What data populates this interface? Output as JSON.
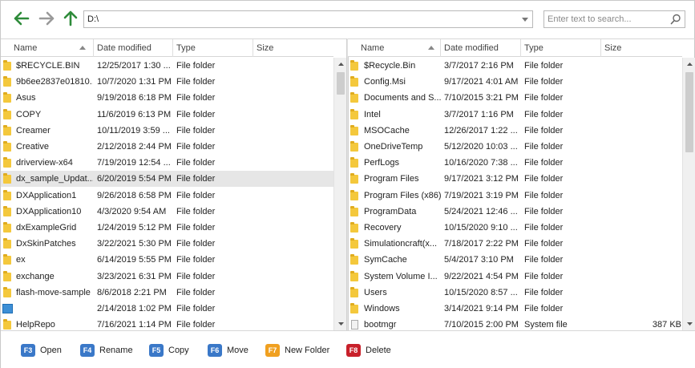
{
  "toolbar": {
    "address_value": "D:\\",
    "search_placeholder": "Enter text to search..."
  },
  "columns": {
    "name": "Name",
    "date": "Date modified",
    "type": "Type",
    "size": "Size"
  },
  "left_pane": {
    "rows": [
      {
        "name": "$RECYCLE.BIN",
        "date": "12/25/2017 1:30 ...",
        "type": "File folder",
        "size": "",
        "icon": "folder-icon"
      },
      {
        "name": "9b6ee2837e01810...",
        "date": "10/7/2020 1:31 PM",
        "type": "File folder",
        "size": "",
        "icon": "folder-icon"
      },
      {
        "name": "Asus",
        "date": "9/19/2018 6:18 PM",
        "type": "File folder",
        "size": "",
        "icon": "folder-icon"
      },
      {
        "name": "COPY",
        "date": "11/6/2019 6:13 PM",
        "type": "File folder",
        "size": "",
        "icon": "folder-icon"
      },
      {
        "name": "Creamer",
        "date": "10/11/2019 3:59 ...",
        "type": "File folder",
        "size": "",
        "icon": "folder-icon"
      },
      {
        "name": "Creative",
        "date": "2/12/2018 2:44 PM",
        "type": "File folder",
        "size": "",
        "icon": "folder-icon"
      },
      {
        "name": "driverview-x64",
        "date": "7/19/2019 12:54 ...",
        "type": "File folder",
        "size": "",
        "icon": "folder-icon"
      },
      {
        "name": "dx_sample_Updat...",
        "date": "6/20/2019 5:54 PM",
        "type": "File folder",
        "size": "",
        "icon": "folder-icon"
      },
      {
        "name": "DXApplication1",
        "date": "9/26/2018 6:58 PM",
        "type": "File folder",
        "size": "",
        "icon": "folder-icon"
      },
      {
        "name": "DXApplication10",
        "date": "4/3/2020 9:54 AM",
        "type": "File folder",
        "size": "",
        "icon": "folder-icon"
      },
      {
        "name": "dxExampleGrid",
        "date": "1/24/2019 5:12 PM",
        "type": "File folder",
        "size": "",
        "icon": "folder-icon"
      },
      {
        "name": "DxSkinPatches",
        "date": "3/22/2021 5:30 PM",
        "type": "File folder",
        "size": "",
        "icon": "folder-icon"
      },
      {
        "name": "ex",
        "date": "6/14/2019 5:55 PM",
        "type": "File folder",
        "size": "",
        "icon": "folder-icon"
      },
      {
        "name": "exchange",
        "date": "3/23/2021 6:31 PM",
        "type": "File folder",
        "size": "",
        "icon": "folder-icon"
      },
      {
        "name": "flash-move-sample",
        "date": "8/6/2018 2:21 PM",
        "type": "File folder",
        "size": "",
        "icon": "folder-icon"
      },
      {
        "name": "",
        "date": "2/14/2018 1:02 PM",
        "type": "File folder",
        "size": "",
        "icon": "app-icon"
      },
      {
        "name": "HelpRepo",
        "date": "7/16/2021 1:14 PM",
        "type": "File folder",
        "size": "",
        "icon": "folder-icon"
      }
    ],
    "selected_index": 7
  },
  "right_pane": {
    "rows": [
      {
        "name": "$Recycle.Bin",
        "date": "3/7/2017 2:16 PM",
        "type": "File folder",
        "size": "",
        "icon": "folder-icon"
      },
      {
        "name": "Config.Msi",
        "date": "9/17/2021 4:01 AM",
        "type": "File folder",
        "size": "",
        "icon": "folder-icon"
      },
      {
        "name": "Documents and S...",
        "date": "7/10/2015 3:21 PM",
        "type": "File folder",
        "size": "",
        "icon": "folder-icon"
      },
      {
        "name": "Intel",
        "date": "3/7/2017 1:16 PM",
        "type": "File folder",
        "size": "",
        "icon": "folder-icon"
      },
      {
        "name": "MSOCache",
        "date": "12/26/2017 1:22 ...",
        "type": "File folder",
        "size": "",
        "icon": "folder-icon"
      },
      {
        "name": "OneDriveTemp",
        "date": "5/12/2020 10:03 ...",
        "type": "File folder",
        "size": "",
        "icon": "folder-icon"
      },
      {
        "name": "PerfLogs",
        "date": "10/16/2020 7:38 ...",
        "type": "File folder",
        "size": "",
        "icon": "folder-icon"
      },
      {
        "name": "Program Files",
        "date": "9/17/2021 3:12 PM",
        "type": "File folder",
        "size": "",
        "icon": "folder-icon"
      },
      {
        "name": "Program Files (x86)",
        "date": "7/19/2021 3:19 PM",
        "type": "File folder",
        "size": "",
        "icon": "folder-icon"
      },
      {
        "name": "ProgramData",
        "date": "5/24/2021 12:46 ...",
        "type": "File folder",
        "size": "",
        "icon": "folder-icon"
      },
      {
        "name": "Recovery",
        "date": "10/15/2020 9:10 ...",
        "type": "File folder",
        "size": "",
        "icon": "folder-icon"
      },
      {
        "name": "Simulationcraft(x...",
        "date": "7/18/2017 2:22 PM",
        "type": "File folder",
        "size": "",
        "icon": "folder-icon"
      },
      {
        "name": "SymCache",
        "date": "5/4/2017 3:10 PM",
        "type": "File folder",
        "size": "",
        "icon": "folder-icon"
      },
      {
        "name": "System Volume I...",
        "date": "9/22/2021 4:54 PM",
        "type": "File folder",
        "size": "",
        "icon": "folder-icon"
      },
      {
        "name": "Users",
        "date": "10/15/2020 8:57 ...",
        "type": "File folder",
        "size": "",
        "icon": "folder-icon"
      },
      {
        "name": "Windows",
        "date": "3/14/2021 9:14 PM",
        "type": "File folder",
        "size": "",
        "icon": "folder-icon"
      },
      {
        "name": "bootmgr",
        "date": "7/10/2015 2:00 PM",
        "type": "System file",
        "size": "387 KB",
        "icon": "file-icon"
      }
    ],
    "selected_index": -1
  },
  "commands": [
    {
      "key": "F3",
      "label": "Open",
      "color": "#3a78c8"
    },
    {
      "key": "F4",
      "label": "Rename",
      "color": "#3a78c8"
    },
    {
      "key": "F5",
      "label": "Copy",
      "color": "#3a78c8"
    },
    {
      "key": "F6",
      "label": "Move",
      "color": "#3a78c8"
    },
    {
      "key": "F7",
      "label": "New Folder",
      "color": "#f0a020"
    },
    {
      "key": "F8",
      "label": "Delete",
      "color": "#c8202a"
    }
  ],
  "colors": {
    "nav_arrow": "#2e8b3a",
    "nav_arrow_disabled": "#9a9a9a",
    "selection": "#e6e6e6"
  }
}
